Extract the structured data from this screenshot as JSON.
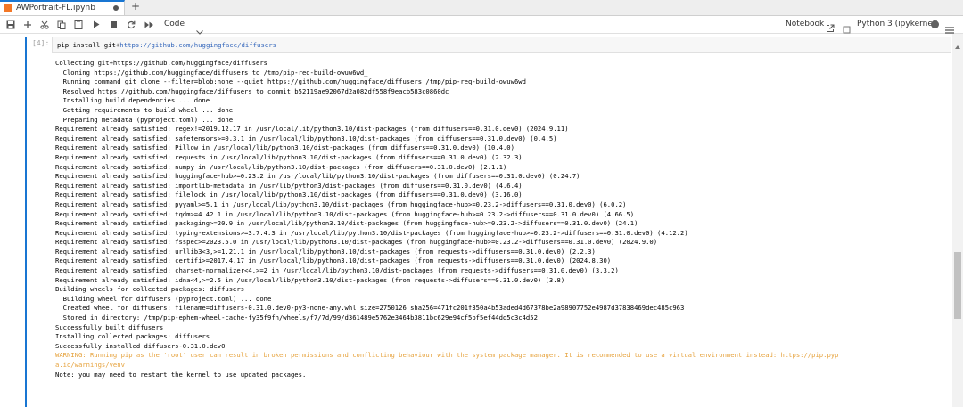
{
  "tab": {
    "title": "AWPortrait-FL.ipynb",
    "new_tab_label": "+"
  },
  "toolbar": {
    "cell_type": "Code",
    "notebook_label": "Notebook",
    "kernel_label": "Python 3 (ipykernel)",
    "icons": [
      "save-icon",
      "add-icon",
      "cut-icon",
      "copy-icon",
      "paste-icon",
      "run-icon",
      "stop-icon",
      "restart-icon",
      "fast-forward-icon"
    ]
  },
  "cell": {
    "prompt": "[4]:",
    "input_prefix": "pip install git+",
    "input_url": "https://github.com/huggingface/diffusers",
    "output_lines": [
      "Collecting git+https://github.com/huggingface/diffusers",
      "  Cloning https://github.com/huggingface/diffusers to /tmp/pip-req-build-owuw6wd_",
      "  Running command git clone --filter=blob:none --quiet https://github.com/huggingface/diffusers /tmp/pip-req-build-owuw6wd_",
      "  Resolved https://github.com/huggingface/diffusers to commit b52119ae92067d2a082df558f9eacb583c0860dc",
      "  Installing build dependencies ... done",
      "  Getting requirements to build wheel ... done",
      "  Preparing metadata (pyproject.toml) ... done",
      "Requirement already satisfied: regex!=2019.12.17 in /usr/local/lib/python3.10/dist-packages (from diffusers==0.31.0.dev0) (2024.9.11)",
      "Requirement already satisfied: safetensors>=0.3.1 in /usr/local/lib/python3.10/dist-packages (from diffusers==0.31.0.dev0) (0.4.5)",
      "Requirement already satisfied: Pillow in /usr/local/lib/python3.10/dist-packages (from diffusers==0.31.0.dev0) (10.4.0)",
      "Requirement already satisfied: requests in /usr/local/lib/python3.10/dist-packages (from diffusers==0.31.0.dev0) (2.32.3)",
      "Requirement already satisfied: numpy in /usr/local/lib/python3.10/dist-packages (from diffusers==0.31.0.dev0) (2.1.1)",
      "Requirement already satisfied: huggingface-hub>=0.23.2 in /usr/local/lib/python3.10/dist-packages (from diffusers==0.31.0.dev0) (0.24.7)",
      "Requirement already satisfied: importlib-metadata in /usr/lib/python3/dist-packages (from diffusers==0.31.0.dev0) (4.6.4)",
      "Requirement already satisfied: filelock in /usr/local/lib/python3.10/dist-packages (from diffusers==0.31.0.dev0) (3.16.0)",
      "Requirement already satisfied: pyyaml>=5.1 in /usr/local/lib/python3.10/dist-packages (from huggingface-hub>=0.23.2->diffusers==0.31.0.dev0) (6.0.2)",
      "Requirement already satisfied: tqdm>=4.42.1 in /usr/local/lib/python3.10/dist-packages (from huggingface-hub>=0.23.2->diffusers==0.31.0.dev0) (4.66.5)",
      "Requirement already satisfied: packaging>=20.9 in /usr/local/lib/python3.10/dist-packages (from huggingface-hub>=0.23.2->diffusers==0.31.0.dev0) (24.1)",
      "Requirement already satisfied: typing-extensions>=3.7.4.3 in /usr/local/lib/python3.10/dist-packages (from huggingface-hub>=0.23.2->diffusers==0.31.0.dev0) (4.12.2)",
      "Requirement already satisfied: fsspec>=2023.5.0 in /usr/local/lib/python3.10/dist-packages (from huggingface-hub>=0.23.2->diffusers==0.31.0.dev0) (2024.9.0)",
      "Requirement already satisfied: urllib3<3,>=1.21.1 in /usr/local/lib/python3.10/dist-packages (from requests->diffusers==0.31.0.dev0) (2.2.3)",
      "Requirement already satisfied: certifi>=2017.4.17 in /usr/local/lib/python3.10/dist-packages (from requests->diffusers==0.31.0.dev0) (2024.8.30)",
      "Requirement already satisfied: charset-normalizer<4,>=2 in /usr/local/lib/python3.10/dist-packages (from requests->diffusers==0.31.0.dev0) (3.3.2)",
      "Requirement already satisfied: idna<4,>=2.5 in /usr/local/lib/python3.10/dist-packages (from requests->diffusers==0.31.0.dev0) (3.8)",
      "Building wheels for collected packages: diffusers",
      "  Building wheel for diffusers (pyproject.toml) ... done",
      "  Created wheel for diffusers: filename=diffusers-0.31.0.dev0-py3-none-any.whl size=2750126 sha256=471fc201f350a4b53aded4d67378be2a98907752e4987d37838469dec485c963",
      "  Stored in directory: /tmp/pip-ephem-wheel-cache-fy35f9fn/wheels/f7/7d/99/d361489e5762e3464b3811bc629e94cf5bf5ef44dd5c3c4d52",
      "Successfully built diffusers",
      "Installing collected packages: diffusers",
      "Successfully installed diffusers-0.31.0.dev0",
      "WARNING: Running pip as the 'root' user can result in broken permissions and conflicting behaviour with the system package manager. It is recommended to use a virtual environment instead: https://pip.pyp",
      "a.io/warnings/venv",
      "Note: you may need to restart the kernel to use updated packages."
    ],
    "warning_line_indices": [
      31,
      32
    ]
  },
  "colors": {
    "accent": "#1976d2",
    "warning": "#e6a23c",
    "link": "#3366bb"
  }
}
